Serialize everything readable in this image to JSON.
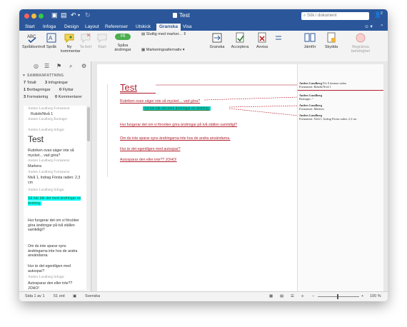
{
  "window": {
    "title": "Test",
    "search_placeholder": "Sök i dokument",
    "user_count": "2"
  },
  "tabs": [
    "Start",
    "Infoga",
    "Design",
    "Layout",
    "Referenser",
    "Utskick",
    "Granska",
    "Visa"
  ],
  "active_tab": "Granska",
  "ribbon": {
    "spellcheck": "Språkkontroll",
    "language": "Språk",
    "new_comment": "Ny kommentar",
    "delete": "Ta bort",
    "previous": "Klart",
    "track_changes_toggle": "PÅ",
    "track_changes": "Spåra ändringar",
    "markup_view": "Slutlig med marker...",
    "markup_options": "Markeringsalternativ",
    "reviewing": "Granska",
    "accept": "Acceptera",
    "reject": "Avvisa",
    "compare": "Jämför",
    "protect": "Skydda",
    "restrict": "Begränsa behörighet"
  },
  "summary": {
    "header": "SAMMANFATTNING",
    "total_n": "7",
    "total_label": "Totalt",
    "insertions_n": "3",
    "insertions_label": "Infogningar",
    "deletions_n": "1",
    "deletions_label": "Borttagningar",
    "moves_n": "0",
    "moves_label": "Flyttar",
    "formatting_n": "3",
    "formatting_label": "Formatering",
    "comments_n": "0",
    "comments_label": "Kommentarer"
  },
  "revisions": {
    "r1_meta": "Anders Lundberg Formaterat",
    "r1_text": "Rubrik/Nivå 1",
    "r2_meta": "Anders Lundberg Borttaget",
    "r3_meta": "Anders Lundberg Infogat",
    "r3_text": "Test",
    "r3_text2": "Rubriken ovan säger inte så mycket... vad göra?",
    "r4_meta": "Anders Lundberg Formaterat",
    "r4_text": "Markera",
    "r5_meta": "Anders Lundberg Formaterat",
    "r5_text": "Nivå 1, Indrag Första raden: 2,3 cm",
    "r6_meta": "Anders Lundberg Infogat",
    "r6_text": "Så här blir det med ändringar en ändring.",
    "r6_text2": "Hur fungerar det om vi försöker göra ändringar på två ställen samtidigt?",
    "r6_text3": "Om du inte sparar syns ändringarna inte hos de andra användarna.",
    "r6_text4": "Hur är det egentligen med autospar?",
    "r7_meta": "Anders Lundberg Infogat",
    "r7_text": "Autosparar den eller inte?? JOHO!"
  },
  "document": {
    "title": "Test",
    "line1": "Rubriken ovan säger inte så mycket… vad göra?",
    "line2": "Så här blir det med ändringar en ändring.",
    "line3": "Hur fungerar det om vi försöker göra ändringar på två ställen samtidigt?",
    "line4": "Om du inte sparar syns ändringarna inte hos de andra användarna.",
    "line5": "Hur är det egentligen med autospar?",
    "line6": "Autosparar den eller inte?? JOHO!"
  },
  "balloons": [
    {
      "author": "Anders Lundberg",
      "text": "Formaterat: Rubrik/Nivå 1",
      "extra": "För 9 timmar sedan"
    },
    {
      "author": "Anders Lundberg",
      "text": "Borttaget: ^"
    },
    {
      "author": "Anders Lundberg",
      "text": "Formaterat: Markera"
    },
    {
      "author": "Anders Lundberg",
      "text": "Formaterat: Nivå 1, Indrag Första raden: 2,3 cm"
    }
  ],
  "statusbar": {
    "page": "Sida 1 av 1",
    "words": "51 ord",
    "language": "Svenska",
    "zoom": "100 %"
  },
  "colors": {
    "titlebar": "#2b579a",
    "revision_red": "#b01f2d",
    "highlight": "#00ffff"
  }
}
